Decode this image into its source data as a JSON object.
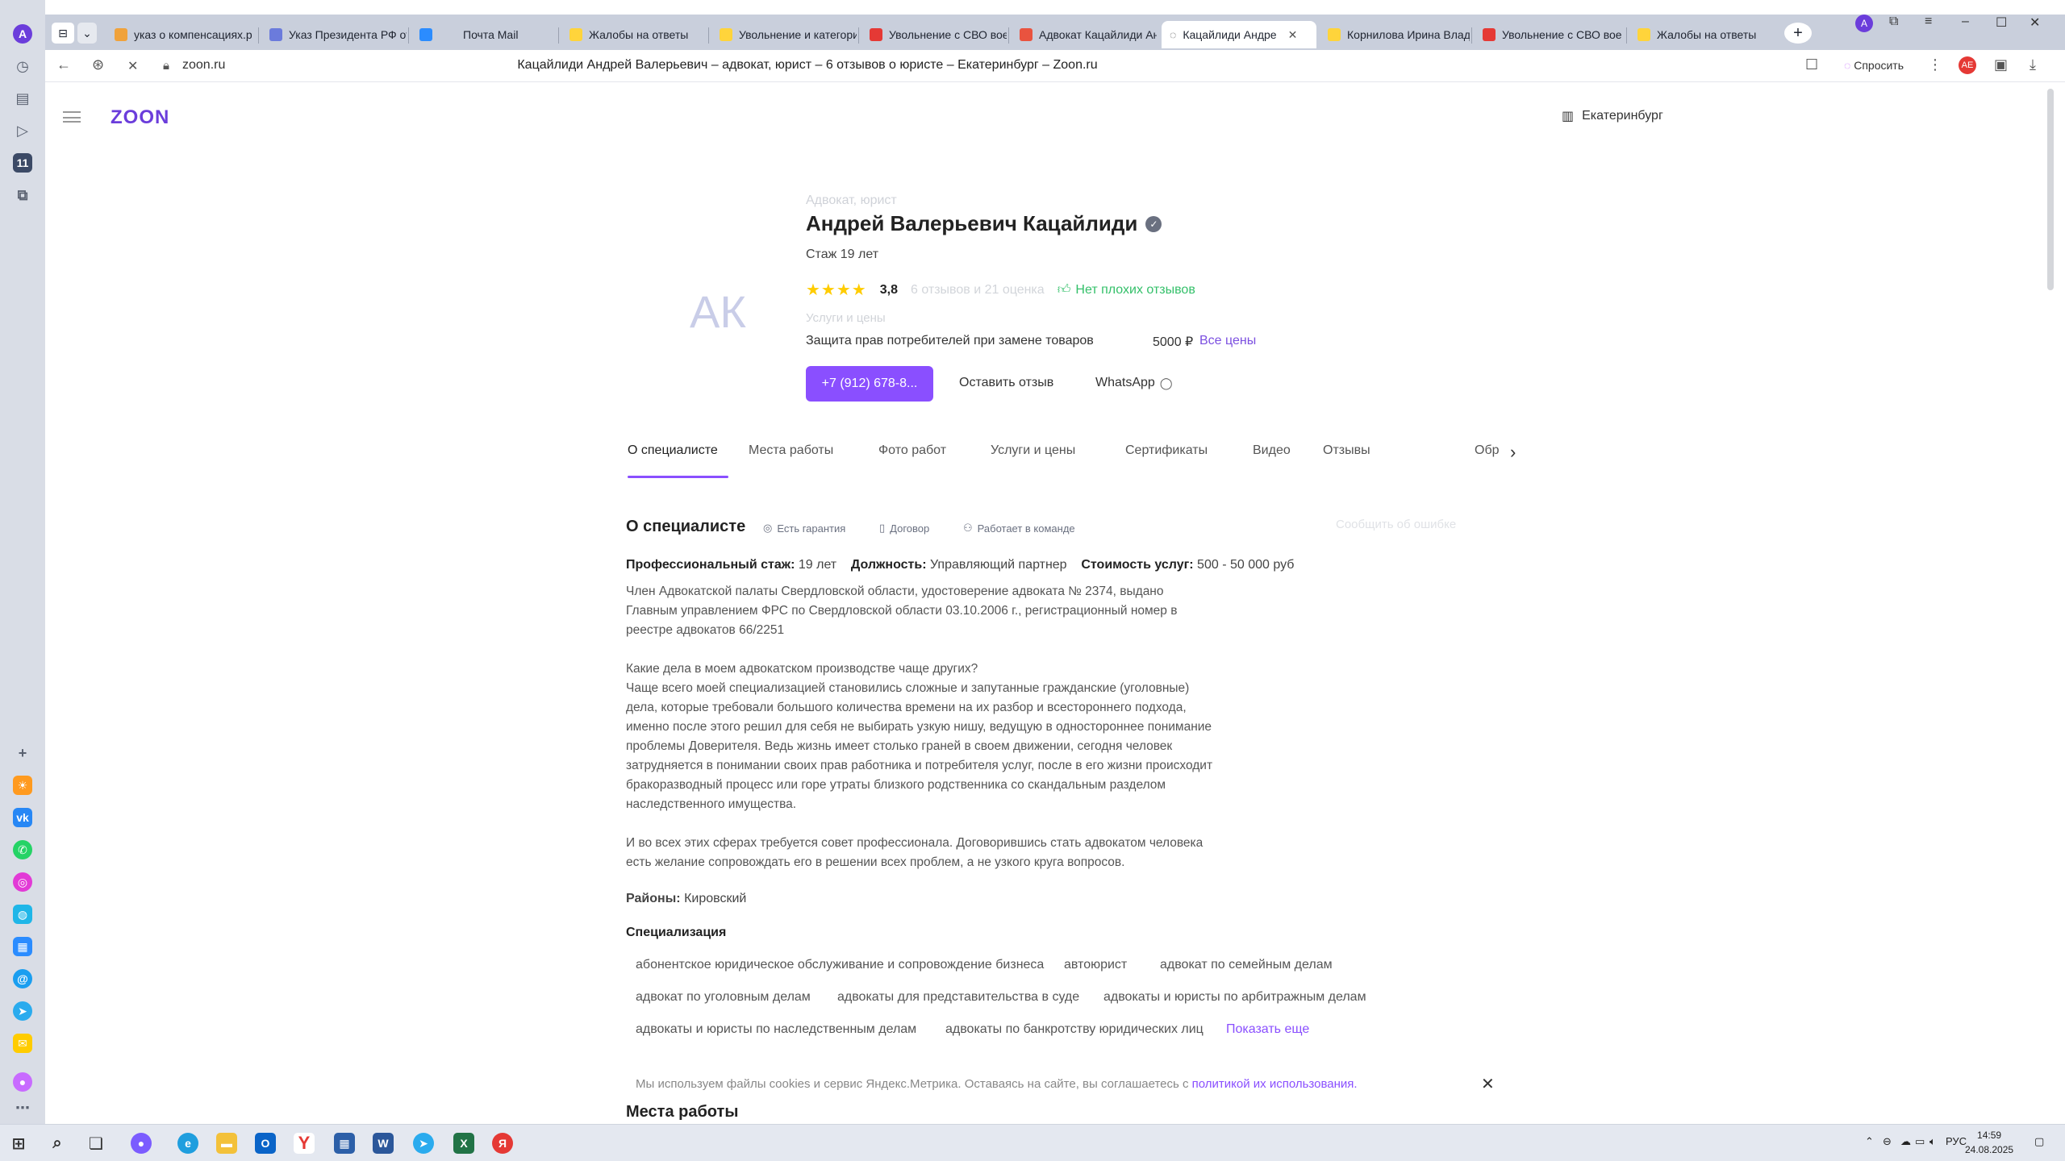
{
  "browser": {
    "tabs": [
      {
        "label": "указ о компенсациях.р",
        "color": "#f0a23b"
      },
      {
        "label": "Указ Президента РФ от",
        "color": "#6b7bdc"
      },
      {
        "label": "Почта Mail",
        "color": "#2b8cff"
      },
      {
        "label": "Жалобы на ответы",
        "color": "#ffd43b"
      },
      {
        "label": "Увольнение и категори",
        "color": "#ffd43b"
      },
      {
        "label": "Увольнение с СВО вое",
        "color": "#e53935"
      },
      {
        "label": "Адвокат Кацайлиди Ан",
        "color": "#e9533f"
      },
      {
        "label": "Кацайлиди Андре",
        "color": "#444444"
      },
      {
        "label": "Корнилова Ирина Влад",
        "color": "#ffd43b"
      },
      {
        "label": "Увольнение с СВО вое",
        "color": "#e53935"
      },
      {
        "label": "Жалобы на ответы",
        "color": "#ffd43b"
      }
    ],
    "url": "zoon.ru",
    "page_title": "Кацайлиди Андрей Валерьевич – адвокат, юрист – 6 отзывов о юристе – Екатеринбург – Zoon.ru",
    "ask_label": "Спросить"
  },
  "site": {
    "logo": "ZOON",
    "city": "Екатеринбург"
  },
  "profile": {
    "avatar_initials": "АК",
    "category": "Адвокат, юрист",
    "name": "Андрей Валерьевич Кацайлиди",
    "experience": "Стаж 19 лет",
    "stars": "★★★★",
    "rating": "3,8",
    "reviews_count": "6 отзывов и 21 оценка",
    "no_bad_reviews": "Нет плохих отзывов",
    "services_header": "Услуги и цены",
    "service_name": "Защита прав потребителей при замене товаров",
    "service_price": "5000 ₽",
    "all_prices": "Все цены",
    "phone_button": "+7 (912) 678-8...",
    "review_button": "Оставить отзыв",
    "whatsapp_button": "WhatsApp"
  },
  "page_tabs": [
    "О специалисте",
    "Места работы",
    "Фото работ",
    "Услуги и цены",
    "Сертификаты",
    "Видео",
    "Отзывы",
    "Обр"
  ],
  "about": {
    "title": "О специалисте",
    "badges": [
      "Есть гарантия",
      "Договор",
      "Работает в команде"
    ],
    "report_error": "Сообщить об ошибке",
    "exp_label": "Профессиональный стаж:",
    "exp_value": "19 лет",
    "position_label": "Должность:",
    "position_value": "Управляющий партнер",
    "cost_label": "Стоимость услуг:",
    "cost_value": "500 - 50 000 руб",
    "para1": "Член Адвокатской палаты Свердловской области, удостоверение адвоката № 2374, выдано\nГлавным управлением ФРС по Свердловской области 03.10.2006 г., регистрационный номер в\nреестре адвокатов 66/2251",
    "para2": "Какие дела в моем адвокатском производстве чаще других?\nЧаще всего моей специализацией становились сложные и запутанные гражданские (уголовные)\nдела, которые требовали большого количества времени на их разбор и всестороннего подхода,\nименно после этого решил для себя не выбирать узкую нишу, ведущую в одностороннее понимание\nпроблемы Доверителя. Ведь жизнь имеет столько граней в своем движении, сегодня человек\nзатрудняется в понимании своих прав работника и потребителя услуг, после в его жизни происходит\nбракоразводный процесс или горе утраты близкого родственника со скандальным разделом\nнаследственного имущества.",
    "para3": "И во всех этих сферах требуется совет профессионала. Договорившись стать адвокатом человека\nесть желание сопровождать его в решении всех проблем, а не узкого круга вопросов.",
    "districts_label": "Районы:",
    "districts_value": "Кировский",
    "spec_title": "Специализация",
    "specializations": [
      "абонентское юридическое обслуживание и сопровождение бизнеса",
      "автоюрист",
      "адвокат по семейным делам",
      "адвокат по уголовным делам",
      "адвокаты для представительства в суде",
      "адвокаты и юристы по арбитражным делам",
      "адвокаты и юристы по наследственным делам",
      "адвокаты по банкротству юридических лиц"
    ],
    "show_more": "Показать еще"
  },
  "cookie": {
    "text": "Мы используем файлы cookies и сервис Яндекс.Метрика. Оставаясь на сайте, вы соглашаетесь с ",
    "link": "политикой их использования."
  },
  "places_title": "Места работы",
  "taskbar": {
    "lang": "РУС",
    "time": "14:59",
    "date": "24.08.2025"
  },
  "accent_color": "#8a4fff"
}
